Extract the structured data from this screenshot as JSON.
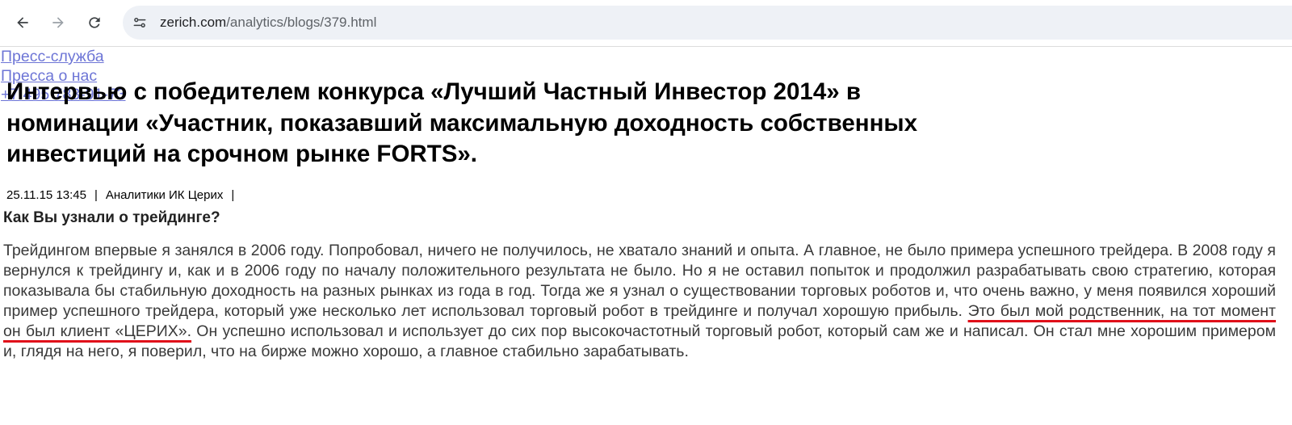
{
  "browser": {
    "url_domain": "zerich.com",
    "url_path": "/analytics/blogs/379.html",
    "icons": [
      "back-arrow-icon",
      "forward-arrow-icon",
      "reload-icon",
      "site-info-icon"
    ]
  },
  "header_links": [
    "Пресс-служба",
    "Пресса о нас",
    "+7 495 783-91-73"
  ],
  "article": {
    "title": "Интервью с победителем конкурса «Лучший Частный Инвестор 2014» в номинации «Участник, показавший максимальную доходность собственных инвестиций на срочном рынке FORTS».",
    "date": "25.11.15 13:45",
    "separator": "|",
    "author": "Аналитики ИК Церих",
    "question": "Как Вы узнали о трейдинге?",
    "paragraph_before": "Трейдингом впервые я занялся в 2006 году. Попробовал, ничего не получилось, не хватало знаний и опыта. А главное, не было примера успешного трейдера. В 2008 году я вернулся к трейдингу и, как и в 2006 году по началу положительного результата не было. Но я не оставил попыток и продолжил разрабатывать свою стратегию, которая показывала бы стабильную доходность на разных рынках из года в год. Тогда же я узнал о существовании торговых роботов и, что очень важно, у меня появился хороший пример успешного трейдера, который уже несколько лет использовал торговый робот в трейдинге и получал хорошую прибыль. ",
    "paragraph_highlight": "Это был мой родственник, на тот момент он был клиент «ЦЕРИХ».",
    "paragraph_after": " Он успешно использовал и использует до сих пор высокочастотный торговый робот, который сам же и написал. Он стал мне хорошим примером и, глядя на него, я поверил, что на бирже можно хорошо, а главное стабильно зарабатывать."
  },
  "colors": {
    "link": "#6d75d6",
    "highlight_underline": "#e0101a",
    "address_bar_bg": "#eef1f6"
  }
}
